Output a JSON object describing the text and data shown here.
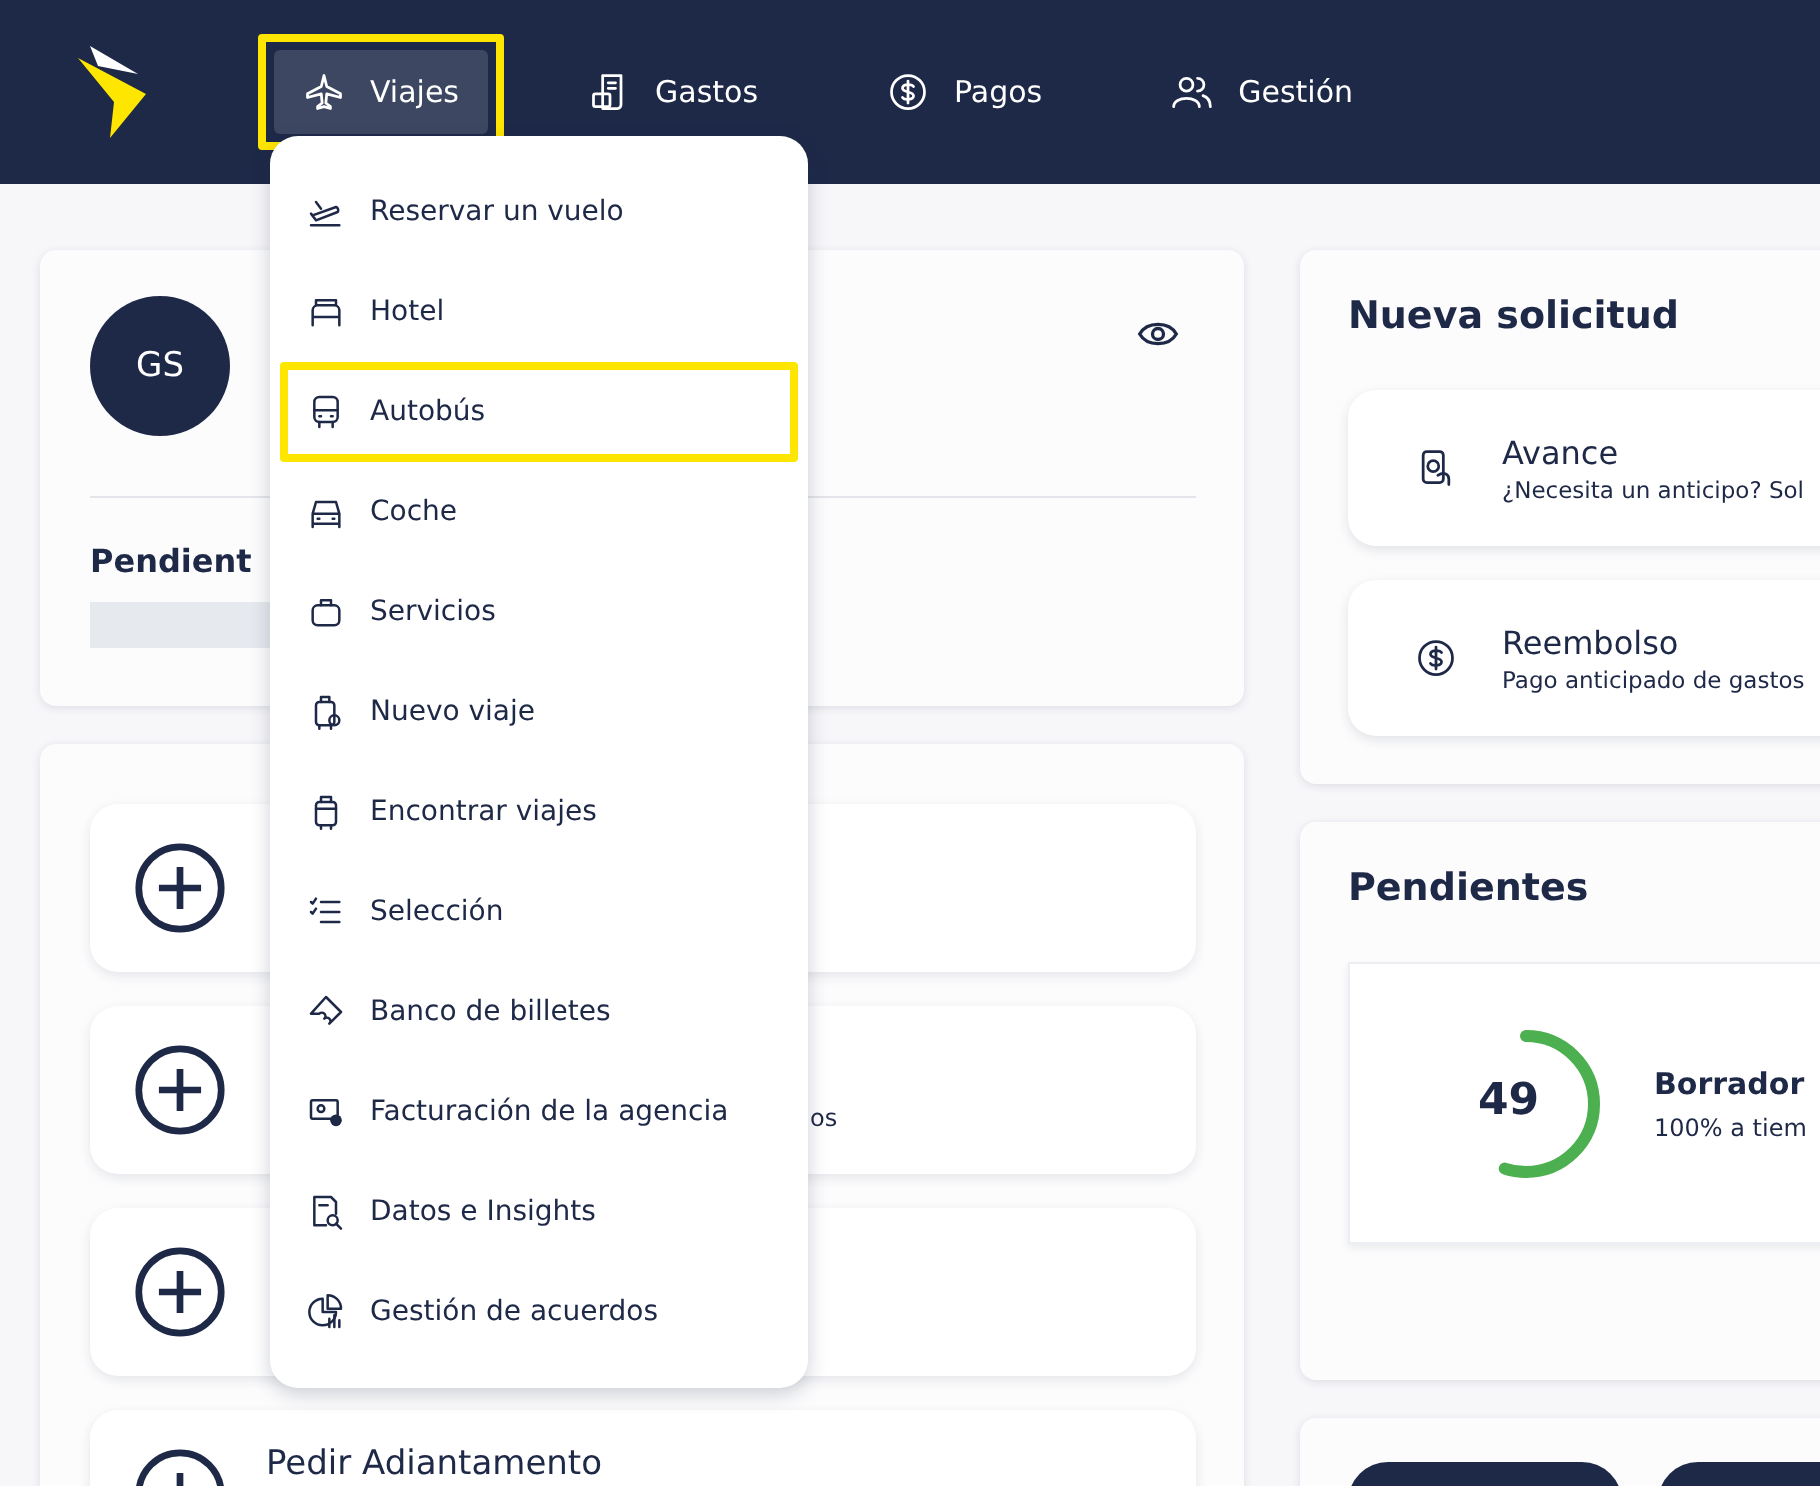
{
  "nav": {
    "items": [
      {
        "label": "Viajes",
        "selected": true,
        "highlighted": true
      },
      {
        "label": "Gastos",
        "selected": false,
        "highlighted": false
      },
      {
        "label": "Pagos",
        "selected": false,
        "highlighted": false
      },
      {
        "label": "Gestión",
        "selected": false,
        "highlighted": false
      }
    ]
  },
  "menu": {
    "items": [
      {
        "label": "Reservar un vuelo",
        "highlighted": false
      },
      {
        "label": "Hotel",
        "highlighted": false
      },
      {
        "label": "Autobús",
        "highlighted": true
      },
      {
        "label": "Coche",
        "highlighted": false
      },
      {
        "label": "Servicios",
        "highlighted": false
      },
      {
        "label": "Nuevo viaje",
        "highlighted": false
      },
      {
        "label": "Encontrar viajes",
        "highlighted": false
      },
      {
        "label": "Selección",
        "highlighted": false
      },
      {
        "label": "Banco de billetes",
        "highlighted": false
      },
      {
        "label": "Facturación de la agencia",
        "highlighted": false
      },
      {
        "label": "Datos e Insights",
        "highlighted": false
      },
      {
        "label": "Gestión de acuerdos",
        "highlighted": false
      }
    ]
  },
  "profile": {
    "initials": "GS",
    "section_title": "Pendient"
  },
  "actions": [
    {
      "kind": "add"
    },
    {
      "kind": "add",
      "subtitle": "os"
    },
    {
      "kind": "add"
    },
    {
      "kind": "add",
      "title": "Pedir Adiantamento"
    }
  ],
  "new_request": {
    "title": "Nueva solicitud",
    "items": [
      {
        "title": "Avance",
        "subtitle": "¿Necesita un anticipo? Sol"
      },
      {
        "title": "Reembolso",
        "subtitle": "Pago anticipado de gastos"
      }
    ]
  },
  "pending": {
    "title": "Pendientes",
    "count": "49",
    "level": 0.55,
    "label": "Borrador",
    "detail": "100% a tiem"
  }
}
